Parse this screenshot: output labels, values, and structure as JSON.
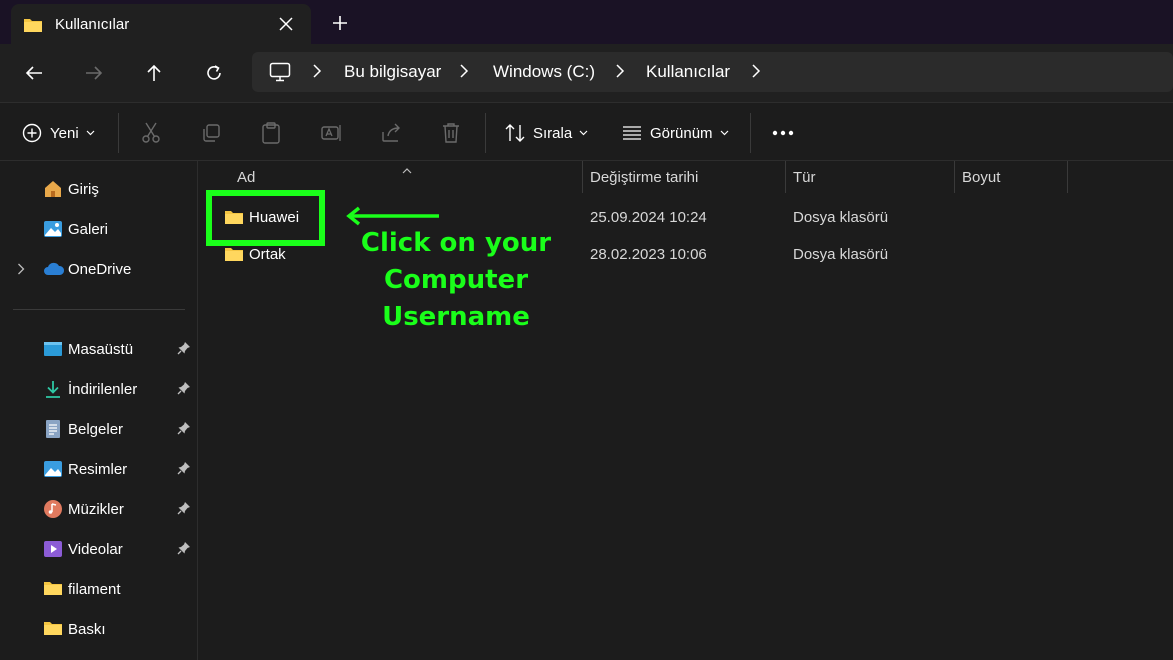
{
  "window": {
    "tab_title": "Kullanıcılar"
  },
  "address_bar": {
    "crumbs": [
      "Bu bilgisayar",
      "Windows (C:)",
      "Kullanıcılar"
    ]
  },
  "toolbar": {
    "new_label": "Yeni",
    "sort_label": "Sırala",
    "view_label": "Görünüm"
  },
  "sidebar": {
    "top_items": [
      {
        "label": "Giriş",
        "icon": "home-icon"
      },
      {
        "label": "Galeri",
        "icon": "gallery-icon"
      },
      {
        "label": "OneDrive",
        "icon": "cloud-icon"
      }
    ],
    "pinned_items": [
      {
        "label": "Masaüstü",
        "icon": "desktop-icon",
        "pinned": true
      },
      {
        "label": "İndirilenler",
        "icon": "download-icon",
        "pinned": true
      },
      {
        "label": "Belgeler",
        "icon": "document-icon",
        "pinned": true
      },
      {
        "label": "Resimler",
        "icon": "pictures-icon",
        "pinned": true
      },
      {
        "label": "Müzikler",
        "icon": "music-icon",
        "pinned": true
      },
      {
        "label": "Videolar",
        "icon": "video-icon",
        "pinned": true
      },
      {
        "label": "filament",
        "icon": "folder-icon",
        "pinned": false
      },
      {
        "label": "Baskı",
        "icon": "folder-icon",
        "pinned": false
      }
    ]
  },
  "file_list": {
    "columns": [
      "Ad",
      "Değiştirme tarihi",
      "Tür",
      "Boyut"
    ],
    "rows": [
      {
        "name": "Huawei",
        "modified": "25.09.2024 10:24",
        "type": "Dosya klasörü",
        "size": ""
      },
      {
        "name": "Ortak",
        "modified": "28.02.2023 10:06",
        "type": "Dosya klasörü",
        "size": ""
      }
    ]
  },
  "annotation": {
    "line1": "Click on your",
    "line2": "Computer",
    "line3": "Username",
    "color": "#1aff1a"
  },
  "colors": {
    "folder": "#f4c542",
    "accent": "#1aff1a"
  }
}
